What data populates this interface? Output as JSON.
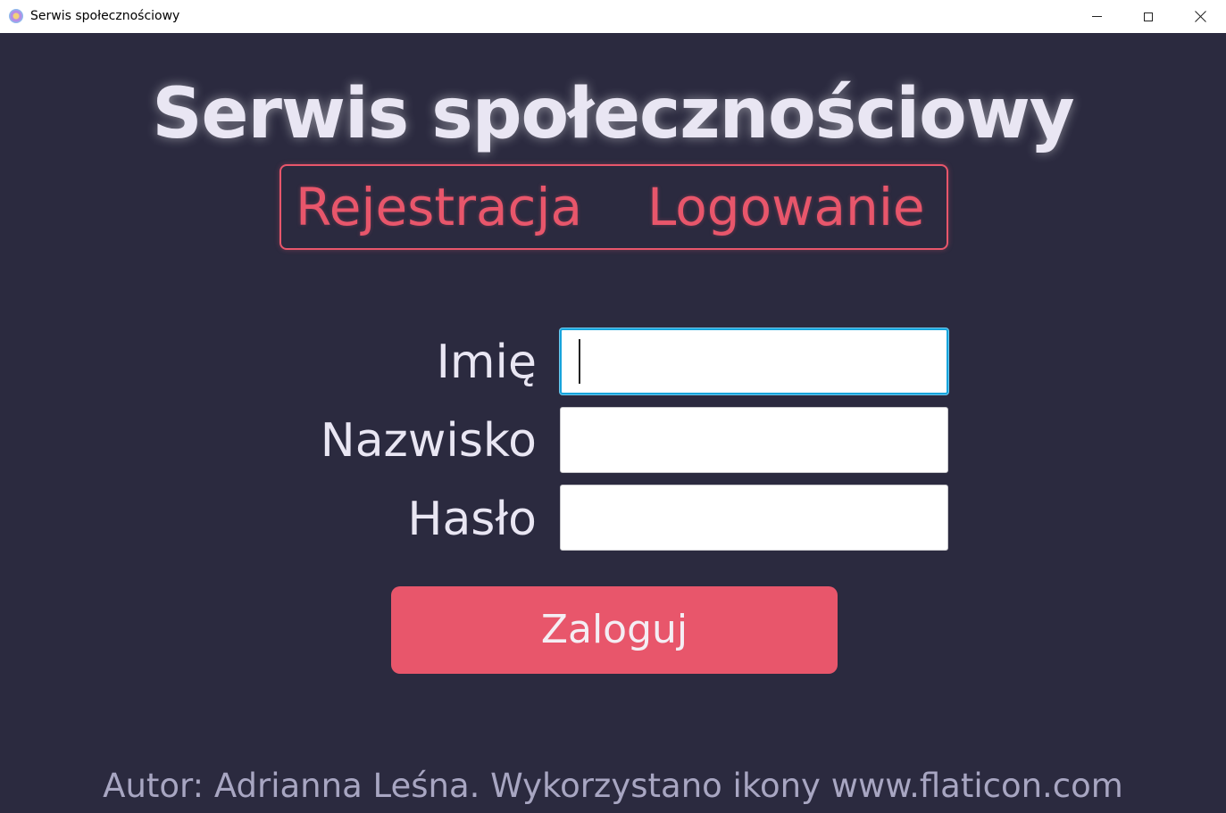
{
  "window": {
    "title": "Serwis społecznościowy"
  },
  "header": {
    "title": "Serwis społecznościowy"
  },
  "tabs": {
    "register_label": "Rejestracja",
    "login_label": "Logowanie"
  },
  "form": {
    "first_name_label": "Imię",
    "first_name_value": "",
    "last_name_label": "Nazwisko",
    "last_name_value": "",
    "password_label": "Hasło",
    "password_value": "",
    "submit_label": "Zaloguj"
  },
  "footer": {
    "text": "Autor: Adrianna Leśna. Wykorzystano ikony www.flaticon.com"
  },
  "icons": {
    "app": "app-icon",
    "minimize": "minimize-icon",
    "maximize": "maximize-icon",
    "close": "close-icon"
  },
  "colors": {
    "background": "#2b2a3f",
    "accent": "#e8566b",
    "text": "#e9e6f3",
    "footer_text": "#a8a6c2",
    "focus_border": "#17a4dc"
  }
}
